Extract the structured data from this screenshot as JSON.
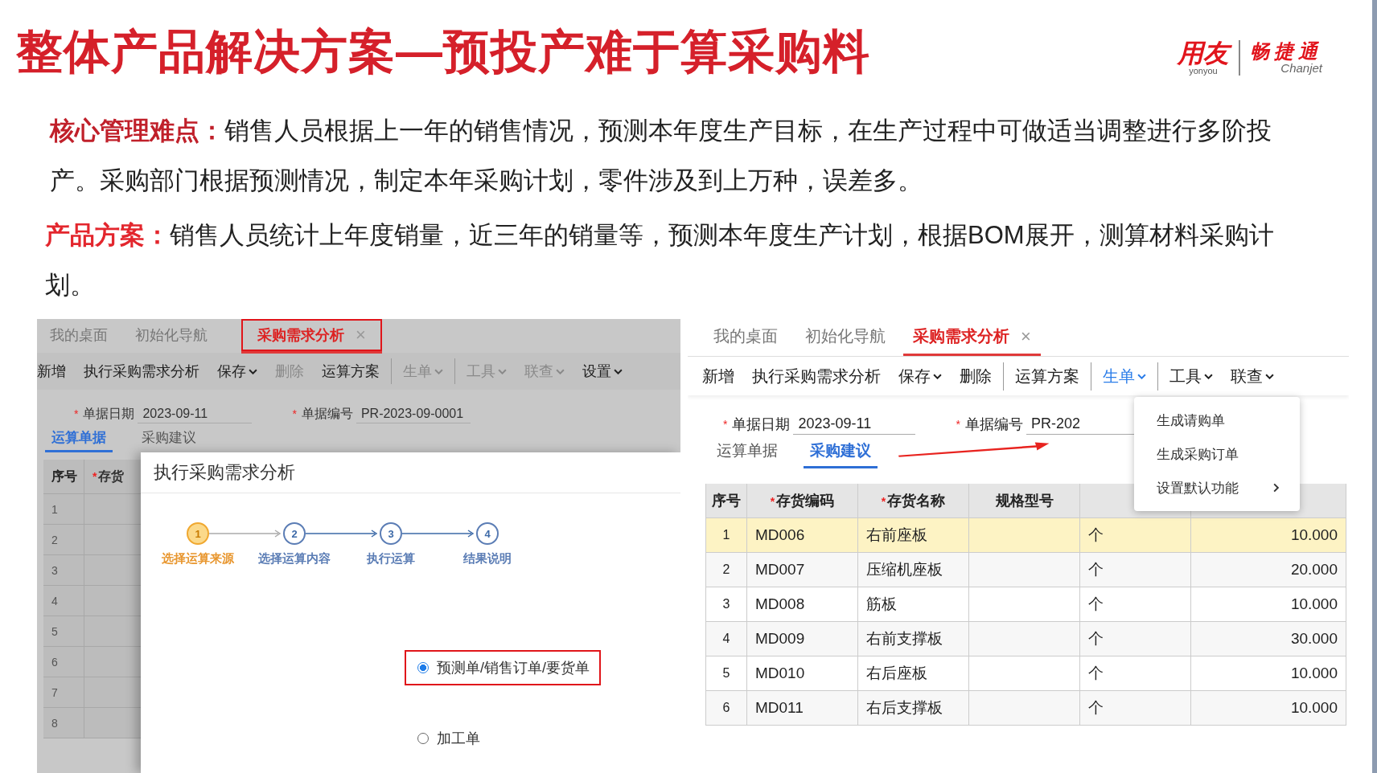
{
  "title": "整体产品解决方案—预投产难于算采购料",
  "logo": {
    "brand": "用友",
    "brand_en": "yonyou",
    "product": "畅捷通",
    "product_en": "Chanjet"
  },
  "paragraphs": [
    {
      "label": "核心管理难点：",
      "text": "销售人员根据上一年的销售情况，预测本年度生产目标，在生产过程中可做适当调整进行多阶投产。采购部门根据预测情况，制定本年采购计划，零件涉及到上万种，误差多。"
    },
    {
      "label": "产品方案：",
      "text": "销售人员统计上年度销量，近三年的销量等，预测本年度生产计划，根据BOM展开，测算材料采购计划。"
    }
  ],
  "left_screen": {
    "tabs": [
      {
        "label": "我的桌面",
        "selected": false,
        "closable": false,
        "annotated": false
      },
      {
        "label": "初始化导航",
        "selected": false,
        "closable": false,
        "annotated": false
      },
      {
        "label": "采购需求分析",
        "selected": true,
        "closable": true,
        "close": "×",
        "annotated": true
      }
    ],
    "toolbar": [
      {
        "label": "新增",
        "dropdown": false,
        "disabled": false,
        "separator_before": false
      },
      {
        "label": "执行采购需求分析",
        "dropdown": false,
        "disabled": false,
        "separator_before": false
      },
      {
        "label": "保存",
        "dropdown": true,
        "disabled": false,
        "separator_before": false
      },
      {
        "label": "删除",
        "dropdown": false,
        "disabled": true,
        "separator_before": false
      },
      {
        "label": "运算方案",
        "dropdown": false,
        "disabled": false,
        "separator_before": false
      },
      {
        "label": "生单",
        "dropdown": true,
        "disabled": true,
        "separator_before": true
      },
      {
        "label": "工具",
        "dropdown": true,
        "disabled": true,
        "separator_before": true
      },
      {
        "label": "联查",
        "dropdown": true,
        "disabled": true,
        "separator_before": false
      },
      {
        "label": "设置",
        "dropdown": true,
        "disabled": false,
        "separator_before": false
      }
    ],
    "fields": [
      {
        "marker": "*",
        "label": "单据日期",
        "value": "2023-09-11"
      },
      {
        "marker": "*",
        "label": "单据编号",
        "value": "PR-2023-09-0001"
      }
    ],
    "subtabs": [
      {
        "label": "运算单据",
        "selected": true
      },
      {
        "label": "采购建议",
        "selected": false
      }
    ],
    "table": {
      "columns": [
        {
          "label": "序号"
        },
        {
          "marker": "*",
          "label": "存货"
        }
      ],
      "rows": [
        "1",
        "2",
        "3",
        "4",
        "5",
        "6",
        "7",
        "8"
      ]
    },
    "dialog": {
      "title": "执行采购需求分析",
      "steps": [
        {
          "number": "1",
          "label": "选择运算来源",
          "selected": true
        },
        {
          "number": "2",
          "label": "选择运算内容",
          "selected": false
        },
        {
          "number": "3",
          "label": "执行运算",
          "selected": false
        },
        {
          "number": "4",
          "label": "结果说明",
          "selected": false
        }
      ],
      "options": [
        {
          "label": "预测单/销售订单/要货单",
          "selected": true,
          "annotated": true
        },
        {
          "label": "加工单",
          "selected": false,
          "annotated": false
        }
      ]
    }
  },
  "right_screen": {
    "tabs": [
      {
        "label": "我的桌面",
        "selected": false,
        "closable": false
      },
      {
        "label": "初始化导航",
        "selected": false,
        "closable": false
      },
      {
        "label": "采购需求分析",
        "selected": true,
        "closable": true,
        "close": "×"
      }
    ],
    "toolbar": [
      {
        "label": "新增",
        "dropdown": false,
        "open": false,
        "separator_before": false
      },
      {
        "label": "执行采购需求分析",
        "dropdown": false,
        "open": false,
        "separator_before": false
      },
      {
        "label": "保存",
        "dropdown": true,
        "open": false,
        "separator_before": false
      },
      {
        "label": "删除",
        "dropdown": false,
        "open": false,
        "separator_before": false
      },
      {
        "label": "运算方案",
        "dropdown": false,
        "open": false,
        "separator_before": true
      },
      {
        "label": "生单",
        "dropdown": true,
        "open": true,
        "separator_before": true
      },
      {
        "label": "工具",
        "dropdown": true,
        "open": false,
        "separator_before": true
      },
      {
        "label": "联查",
        "dropdown": true,
        "open": false,
        "separator_before": false
      }
    ],
    "fields": [
      {
        "marker": "*",
        "label": "单据日期",
        "value": "2023-09-11"
      },
      {
        "marker": "*",
        "label": "单据编号",
        "value": "PR-202"
      }
    ],
    "subtabs": [
      {
        "label": "运算单据",
        "selected": false
      },
      {
        "label": "采购建议",
        "selected": true
      }
    ],
    "table": {
      "columns": [
        {
          "label": "序号"
        },
        {
          "marker": "*",
          "label": "存货编码"
        },
        {
          "marker": "*",
          "label": "存货名称"
        },
        {
          "label": "规格型号"
        }
      ],
      "rows": [
        {
          "cells": [
            "1",
            "MD006",
            "右前座板",
            "",
            "个",
            "10.000"
          ],
          "selected": true
        },
        {
          "cells": [
            "2",
            "MD007",
            "压缩机座板",
            "",
            "个",
            "20.000"
          ],
          "selected": false
        },
        {
          "cells": [
            "3",
            "MD008",
            "筋板",
            "",
            "个",
            "10.000"
          ],
          "selected": false
        },
        {
          "cells": [
            "4",
            "MD009",
            "右前支撑板",
            "",
            "个",
            "30.000"
          ],
          "selected": false
        },
        {
          "cells": [
            "5",
            "MD010",
            "右后座板",
            "",
            "个",
            "10.000"
          ],
          "selected": false
        },
        {
          "cells": [
            "6",
            "MD011",
            "右后支撑板",
            "",
            "个",
            "10.000"
          ],
          "selected": false
        }
      ]
    },
    "menu": [
      {
        "label": "生成请购单",
        "submenu": false
      },
      {
        "label": "生成采购订单",
        "submenu": false
      },
      {
        "label": "设置默认功能",
        "submenu": true
      }
    ]
  }
}
